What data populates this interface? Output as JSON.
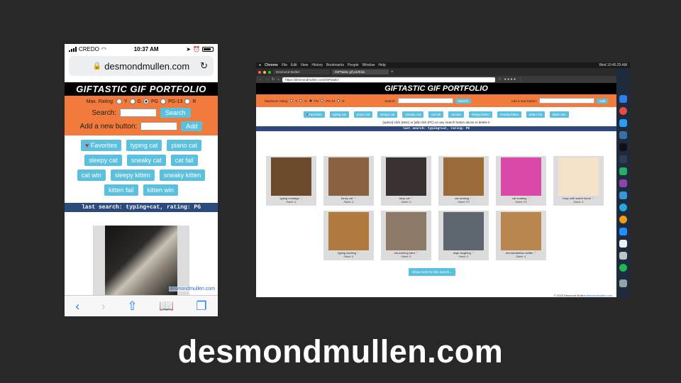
{
  "phone": {
    "status": {
      "carrier": "CREDO",
      "time": "10:37 AM"
    },
    "url": "desmondmullen.com",
    "app_title": "GIFTASTIC GIF PORTFOLIO",
    "rating_label": "Max. Rating:",
    "ratings": [
      "Y",
      "G",
      "PG",
      "PG-13",
      "R"
    ],
    "selected_rating": "PG",
    "search_label": "Search:",
    "search_button": "Search",
    "add_label": "Add a new button:",
    "add_button": "Add",
    "tags": [
      "Favorites",
      "typing cat",
      "piano cat",
      "sleepy cat",
      "sneaky cat",
      "cat fail",
      "cat win",
      "sleepy kitten",
      "sneaky kitten",
      "kitten fail",
      "kitten win"
    ],
    "last_search": "last search: typing+cat, rating: PG",
    "credit": "desmondmullen.com"
  },
  "desktop": {
    "menubar": {
      "apple": "",
      "menus": [
        "Chrome",
        "File",
        "Edit",
        "View",
        "History",
        "Bookmarks",
        "People",
        "Window",
        "Help"
      ],
      "clock": "Wed 10:45:25 AM"
    },
    "tabs": [
      "Desmond Mullen",
      "GIFTastic gif portfolio"
    ],
    "address": "https://desmondmullen.com/GIFtastic/",
    "app_title": "GIFTASTIC GIF PORTFOLIO",
    "rating_label": "Maximum rating:",
    "ratings": [
      "Y",
      "G",
      "PG",
      "PG-13",
      "R"
    ],
    "selected_rating": "PG",
    "search_label": "Search:",
    "search_button": "Search",
    "add_label": "Add a new button:",
    "add_button": "Add",
    "tags": [
      "Favorites",
      "typing cat",
      "piano cat",
      "sleepy cat",
      "sneaky cat",
      "cat fail",
      "cat win",
      "sleepy kitten",
      "sneaky kitten",
      "kitten fail",
      "kitten win"
    ],
    "hint": "[option]-click (Mac) or [alt]-click (PC) on any search button above to delete it",
    "last_search": "last search: typing+cat, rating: PG",
    "gifs": [
      {
        "caption": "typing montage",
        "rating": "Rated: G",
        "color": "#6b4a2e"
      },
      {
        "caption": "funny cat",
        "rating": "Rated: G",
        "color": "#8a6240"
      },
      {
        "caption": "busy cat",
        "rating": "Rated: G",
        "color": "#3a3230"
      },
      {
        "caption": "cat working",
        "rating": "Rated: PG",
        "color": "#9a6a3a"
      },
      {
        "caption": "cat chatting",
        "rating": "Rated: PG",
        "color": "#d94aa8"
      },
      {
        "caption": "busy chib sweet home",
        "rating": "Rated: G",
        "color": "#f4e3c8"
      },
      {
        "caption": "typing working",
        "rating": "Rated: G",
        "color": "#b07a3e"
      },
      {
        "caption": "cat working hard",
        "rating": "Rated: G",
        "color": "#8c7a66"
      },
      {
        "caption": "doge laughing",
        "rating": "Rated: G",
        "color": "#5e6670"
      },
      {
        "caption": "kim kardashian twitter",
        "rating": "Rated: G",
        "color": "#b98650"
      }
    ],
    "show_more": "Show more for this search...",
    "footer_text": "© 2018 Desmond Mullen",
    "footer_link": "desmondmullen.com"
  },
  "caption": "desmondmullen.com"
}
